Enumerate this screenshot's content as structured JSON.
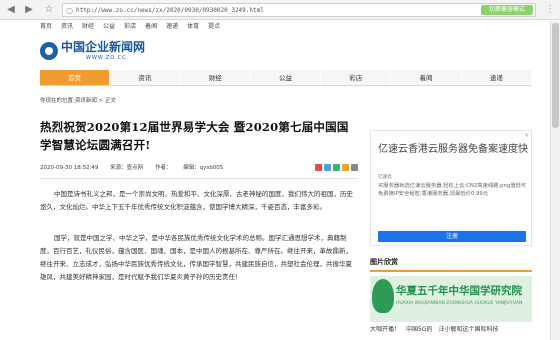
{
  "browser": {
    "url": "http://www.zo.cc/news/zx/2020/0930/0930020_3249.html",
    "mode_button": "切换兼容模式",
    "back_icon": "back-arrow-icon",
    "star_icon": "star-icon"
  },
  "topnav": [
    "首页",
    "资讯",
    "财经",
    "公益",
    "彩店",
    "着闻",
    "速递",
    "体育",
    "提点"
  ],
  "logo": {
    "title": "中国企业新闻网",
    "sub": "WWW.ZO.CC"
  },
  "mainnav": [
    {
      "label": "首页",
      "active": true
    },
    {
      "label": "资讯",
      "active": false
    },
    {
      "label": "财经",
      "active": false
    },
    {
      "label": "公益",
      "active": false
    },
    {
      "label": "彩店",
      "active": false
    },
    {
      "label": "着闻",
      "active": false
    },
    {
      "label": "速递",
      "active": false
    }
  ],
  "breadcrumb": "你现在的位置:资讯新闻 > 正文",
  "article": {
    "title": "热烈祝贺2020第12届世界易学大会 暨2020第七届中国国学智慧论坛圆满召开!",
    "date": "2020-09-30 18:52:49",
    "source": "来源：壹点网",
    "author": "作者：",
    "editor": "编辑：qysb005",
    "paragraphs": [
      "中国是诗书礼义之邦，是一个崇尚文明、热爱和平、文化深厚、古老神秘的国度，我们伟大的祖国，历史悠久，文化灿烂。中华上下五千年优秀传统文化积淀蕴含，使国学博大精深，千姿百态，丰富多彩。",
      "国学，就是中国之学、中华之学，是中华各民族优秀传统文化学术的总称。国学汇通思想学术，典籍制度，百行百艺，礼仪民俗，蕴含国医、国魂、国本，是中国人的根基所在、尊严所在。继往开来，革故鼎新，继往开来、立志成才，弘扬中华民族优秀传统文化，传承国学智慧，共建民族自信，共塑社会伦理，共振华夏雄风，共建美好精神家园，是时代赋予我们华夏炎黄子孙的历史责任！"
    ]
  },
  "ad": {
    "title": "亿速云香港云服务器免备案速度快",
    "sub": "亿速云",
    "desc": "买服务器就选亿速云服务器,轻松上云;CN2高速线路,png值低可免费换IP安全秘密;香港服务器,现最低价0.99元",
    "button": "注册",
    "close": "×"
  },
  "pics": {
    "heading": "图片欣赏",
    "banner_text": "华夏五千年中华国学研究院",
    "banner_sub": "HUAXIA WUQIANNIAN ZHONGHUA GUOXUE YANJIUYUAN",
    "captions": [
      "大咖开播！",
      "中国5G的",
      "汪小敏和这个国际科技"
    ]
  }
}
